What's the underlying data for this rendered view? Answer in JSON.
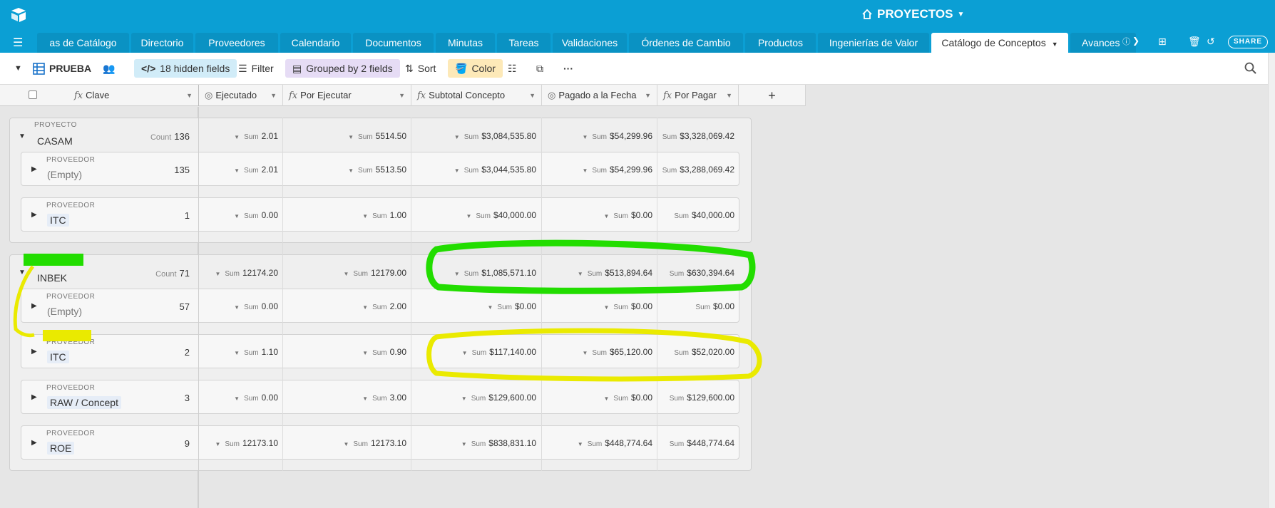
{
  "base": {
    "title": "PROYECTOS"
  },
  "tabs": [
    {
      "label": "as de Catálogo"
    },
    {
      "label": "Directorio"
    },
    {
      "label": "Proveedores"
    },
    {
      "label": "Calendario"
    },
    {
      "label": "Documentos"
    },
    {
      "label": "Minutas"
    },
    {
      "label": "Tareas"
    },
    {
      "label": "Validaciones"
    },
    {
      "label": "Órdenes de Cambio"
    },
    {
      "label": "Productos"
    },
    {
      "label": "Ingenierías de Valor"
    },
    {
      "label": "Catálogo de Conceptos"
    },
    {
      "label": "Avances"
    }
  ],
  "share_label": "SHARE",
  "viewbar": {
    "view_name": "PRUEBA",
    "hidden_fields": "18 hidden fields",
    "filter": "Filter",
    "grouped": "Grouped by 2 fields",
    "sort": "Sort",
    "color": "Color",
    "more": "···"
  },
  "columns": [
    {
      "label": "Clave"
    },
    {
      "label": "Ejecutado"
    },
    {
      "label": "Por Ejecutar"
    },
    {
      "label": "Subtotal Concepto"
    },
    {
      "label": "Pagado a la Fecha"
    },
    {
      "label": "Por Pagar"
    }
  ],
  "labels": {
    "proyecto": "PROYECTO",
    "proveedor": "PROVEEDOR",
    "count": "Count",
    "sum": "Sum",
    "add": "+"
  },
  "groups": [
    {
      "name": "CASAM",
      "count": "136",
      "sums": [
        "2.01",
        "5514.50",
        "$3,084,535.80",
        "$54,299.96",
        "$3,328,069.42"
      ],
      "subs": [
        {
          "name": "(Empty)",
          "count": "135",
          "sums": [
            "2.01",
            "5513.50",
            "$3,044,535.80",
            "$54,299.96",
            "$3,288,069.42"
          ]
        },
        {
          "name": "ITC",
          "count": "1",
          "sums": [
            "0.00",
            "1.00",
            "$40,000.00",
            "$0.00",
            "$40,000.00"
          ]
        }
      ]
    },
    {
      "name": "INBEK",
      "count": "71",
      "sums": [
        "12174.20",
        "12179.00",
        "$1,085,571.10",
        "$513,894.64",
        "$630,394.64"
      ],
      "subs": [
        {
          "name": "(Empty)",
          "count": "57",
          "sums": [
            "0.00",
            "2.00",
            "$0.00",
            "$0.00",
            "$0.00"
          ]
        },
        {
          "name": "ITC",
          "count": "2",
          "sums": [
            "1.10",
            "0.90",
            "$117,140.00",
            "$65,120.00",
            "$52,020.00"
          ]
        },
        {
          "name": "RAW / Concept",
          "count": "3",
          "sums": [
            "0.00",
            "3.00",
            "$129,600.00",
            "$0.00",
            "$129,600.00"
          ]
        },
        {
          "name": "ROE",
          "count": "9",
          "sums": [
            "12173.10",
            "12173.10",
            "$838,831.10",
            "$448,774.64",
            "$448,774.64"
          ]
        }
      ]
    }
  ]
}
